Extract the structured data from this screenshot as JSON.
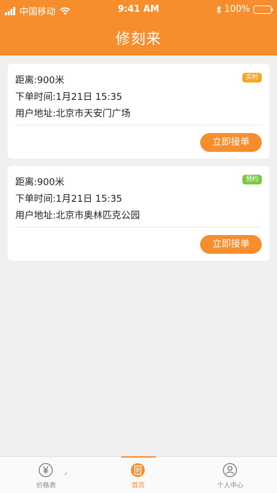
{
  "status_bar": {
    "carrier": "中国移动",
    "time": "9:41 AM",
    "battery": "100%"
  },
  "header": {
    "title": "修刻来"
  },
  "orders": [
    {
      "distance": "距离:900米",
      "order_time": "下单时间:1月21日 15:35",
      "address": "用户地址:北京市天安门广场",
      "badge": "实时",
      "action": "立即接单"
    },
    {
      "distance": "距离:900米",
      "order_time": "下单时间:1月21日 15:35",
      "address": "用户地址:北京市奥林匹克公园",
      "badge": "预约",
      "action": "立即接单"
    }
  ],
  "tabbar": {
    "tabs": [
      {
        "label": "价格表",
        "icon": "yuan-icon"
      },
      {
        "label": "首页",
        "icon": "home-document-icon",
        "active": true
      },
      {
        "label": "个人中心",
        "icon": "person-icon"
      }
    ],
    "check_mark": "✓"
  },
  "colors": {
    "brand": "#f78e2d",
    "badge_realtime": "#f5a623",
    "badge_reserve": "#7ac943"
  }
}
